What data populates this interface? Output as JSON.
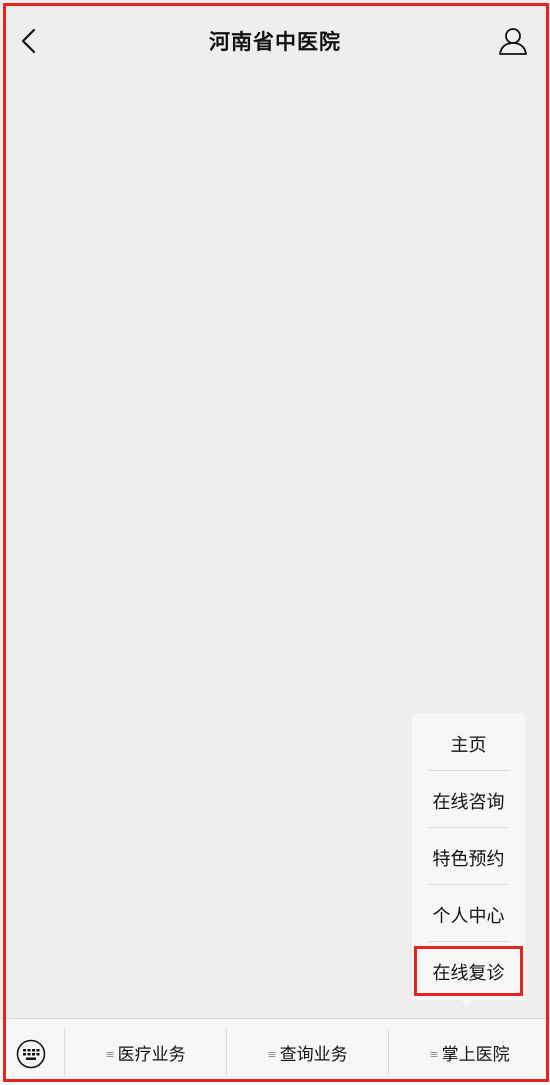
{
  "header": {
    "title": "河南省中医院",
    "back_icon": "chevron-left-icon",
    "profile_icon": "user-icon"
  },
  "menu_popup": {
    "items": [
      {
        "label": "主页"
      },
      {
        "label": "在线咨询"
      },
      {
        "label": "特色预约"
      },
      {
        "label": "个人中心"
      },
      {
        "label": "在线复诊"
      }
    ],
    "highlighted_index": 4
  },
  "bottom_bar": {
    "keyboard_icon": "keyboard-icon",
    "menu_mark": "≡",
    "tabs": [
      {
        "label": "医疗业务"
      },
      {
        "label": "查询业务"
      },
      {
        "label": "掌上医院"
      }
    ]
  },
  "colors": {
    "background": "#efeeec",
    "highlight": "#e8231d",
    "text": "#111111"
  }
}
